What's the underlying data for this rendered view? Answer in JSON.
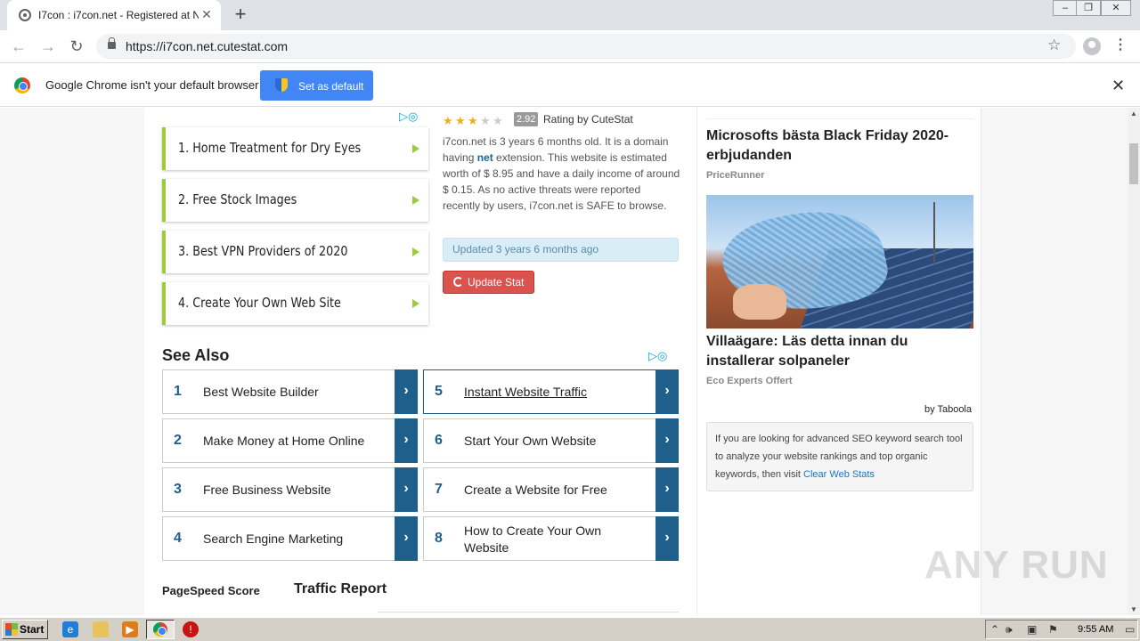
{
  "browser": {
    "tab_title": "I7con : i7con.net - Registered at Na",
    "url": "https://i7con.net.cutestat.com",
    "infobar_text": "Google Chrome isn't your default browser",
    "infobar_button": "Set as default"
  },
  "ads": {
    "items": [
      {
        "label": "1.  Home Treatment for Dry Eyes"
      },
      {
        "label": "2.  Free Stock Images"
      },
      {
        "label": "3.  Best VPN Providers of 2020"
      },
      {
        "label": "4.  Create Your Own Web Site"
      }
    ]
  },
  "rating": {
    "stars_filled": 3,
    "stars_total": 5,
    "score": "2.92",
    "by": "Rating by CuteStat",
    "desc_pre": "i7con.net is 3 years 6 months old. It is a domain having ",
    "desc_ext": "net",
    "desc_post": " extension. This website is estimated worth of $ 8.95 and have a daily income of around $ 0.15. As no active threats were reported recently by users, i7con.net is SAFE to browse.",
    "updated": "Updated 3 years 6 months ago",
    "update_button": "Update Stat"
  },
  "see_also": {
    "title": "See Also",
    "items": [
      {
        "num": "1",
        "label": "Best Website Builder"
      },
      {
        "num": "2",
        "label": "Make Money at Home Online"
      },
      {
        "num": "3",
        "label": "Free Business Website"
      },
      {
        "num": "4",
        "label": "Search Engine Marketing"
      },
      {
        "num": "5",
        "label": "Instant Website Traffic"
      },
      {
        "num": "6",
        "label": "Start Your Own Website"
      },
      {
        "num": "7",
        "label": "Create a Website for Free"
      },
      {
        "num": "8",
        "label": "How to Create Your Own Website"
      }
    ]
  },
  "sections": {
    "pagespeed": "PageSpeed Score",
    "traffic": "Traffic Report"
  },
  "sidebar": {
    "headline1": "Microsofts bästa Black Friday 2020-erbjudanden",
    "source1": "PriceRunner",
    "headline2": "Villaägare: Läs detta innan du installerar solpaneler",
    "source2": "Eco Experts Offert",
    "by_taboola": "by Taboola",
    "seo_text": "If you are looking for advanced SEO keyword search tool to analyze your website rankings and top organic keywords, then visit ",
    "seo_link": "Clear Web Stats"
  },
  "watermark": "ANY RUN",
  "taskbar": {
    "start": "Start",
    "clock": "9:55 AM"
  }
}
